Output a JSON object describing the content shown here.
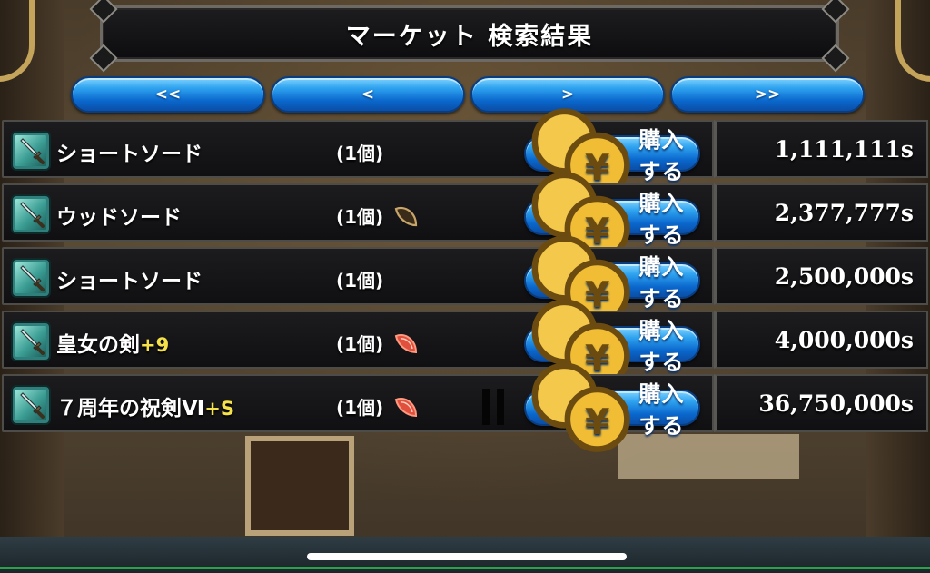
{
  "title": "マーケット 検索結果",
  "pager": {
    "first_label": "<<",
    "prev_label": "<",
    "next_label": ">",
    "last_label": ">>"
  },
  "buy_label": "購入する",
  "items": [
    {
      "name": "ショートソード",
      "plus": "",
      "qty": "(1個)",
      "gem": "none",
      "price": "1,111,111s"
    },
    {
      "name": "ウッドソード",
      "plus": "",
      "qty": "(1個)",
      "gem": "brown-gem-icon",
      "price": "2,377,777s"
    },
    {
      "name": "ショートソード",
      "plus": "",
      "qty": "(1個)",
      "gem": "none",
      "price": "2,500,000s"
    },
    {
      "name": "皇女の剣",
      "plus": "+9",
      "qty": "(1個)",
      "gem": "red-gem-icon",
      "price": "4,000,000s"
    },
    {
      "name": "７周年の祝剣Ⅵ",
      "plus": "+S",
      "qty": "(1個)",
      "gem": "red-gem-icon",
      "price": "36,750,000s"
    }
  ],
  "colors": {
    "button_blue": "#0a67cc",
    "plus_yellow": "#f5e14a",
    "panel_dark": "#101012"
  }
}
